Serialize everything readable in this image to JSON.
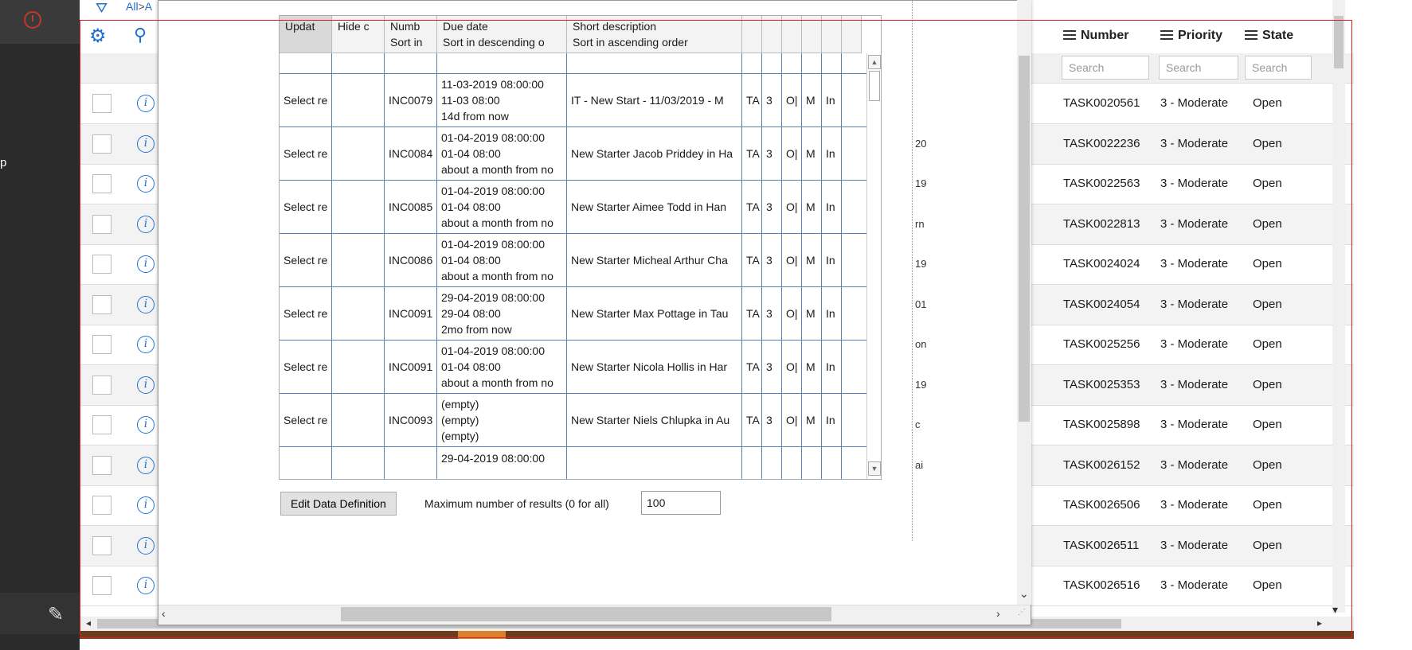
{
  "breadcrumb": {
    "all": "All",
    "sep": ">",
    "rest": "A"
  },
  "leftnav": {
    "partial_text": "p"
  },
  "background_list": {
    "columns": {
      "number": "Number",
      "priority": "Priority",
      "state": "State"
    },
    "search_placeholder": "Search",
    "rows": [
      {
        "number": "TASK0020561",
        "priority": "3 - Moderate",
        "state": "Open",
        "mid": "",
        "alt": false
      },
      {
        "number": "TASK0022236",
        "priority": "3 - Moderate",
        "state": "Open",
        "mid": "20",
        "alt": true
      },
      {
        "number": "TASK0022563",
        "priority": "3 - Moderate",
        "state": "Open",
        "mid": "19",
        "alt": false
      },
      {
        "number": "TASK0022813",
        "priority": "3 - Moderate",
        "state": "Open",
        "mid": "rn",
        "alt": true
      },
      {
        "number": "TASK0024024",
        "priority": "3 - Moderate",
        "state": "Open",
        "mid": "19",
        "alt": false
      },
      {
        "number": "TASK0024054",
        "priority": "3 - Moderate",
        "state": "Open",
        "mid": "01",
        "alt": true
      },
      {
        "number": "TASK0025256",
        "priority": "3 - Moderate",
        "state": "Open",
        "mid": "on",
        "alt": false
      },
      {
        "number": "TASK0025353",
        "priority": "3 - Moderate",
        "state": "Open",
        "mid": "19",
        "alt": true
      },
      {
        "number": "TASK0025898",
        "priority": "3 - Moderate",
        "state": "Open",
        "mid": "c",
        "alt": false
      },
      {
        "number": "TASK0026152",
        "priority": "3 - Moderate",
        "state": "Open",
        "mid": "ai",
        "alt": true
      },
      {
        "number": "TASK0026506",
        "priority": "3 - Moderate",
        "state": "Open",
        "mid": "",
        "alt": false
      },
      {
        "number": "TASK0026511",
        "priority": "3 - Moderate",
        "state": "Open",
        "mid": "",
        "alt": true
      },
      {
        "number": "TASK0026516",
        "priority": "3 - Moderate",
        "state": "Open",
        "mid": "",
        "alt": false
      }
    ]
  },
  "dialog": {
    "table": {
      "headers": [
        {
          "line1": "Updat",
          "line2": ""
        },
        {
          "line1": "Hide c",
          "line2": ""
        },
        {
          "line1": "Numb",
          "line2": "Sort in"
        },
        {
          "line1": "Due date",
          "line2": "Sort in descending o"
        },
        {
          "line1": "Short description",
          "line2": "Sort in ascending order"
        },
        {
          "line1": "",
          "line2": ""
        },
        {
          "line1": "",
          "line2": ""
        },
        {
          "line1": "",
          "line2": ""
        },
        {
          "line1": "",
          "line2": ""
        },
        {
          "line1": "",
          "line2": ""
        },
        {
          "line1": "",
          "line2": ""
        }
      ],
      "rows": [
        {
          "update": "Select re",
          "number": "INC0079",
          "due": [
            "11-03-2019 08:00:00",
            "11-03 08:00",
            "14d from now"
          ],
          "desc": "IT - New Start - 11/03/2019 - M",
          "c5": "TA",
          "c6": "3",
          "c7": "O|",
          "c8": "M",
          "c9": "In"
        },
        {
          "update": "Select re",
          "number": "INC0084",
          "due": [
            "01-04-2019 08:00:00",
            "01-04 08:00",
            "about a month from no"
          ],
          "desc": "New Starter Jacob Priddey in Ha",
          "c5": "TA",
          "c6": "3",
          "c7": "O|",
          "c8": "M",
          "c9": "In"
        },
        {
          "update": "Select re",
          "number": "INC0085",
          "due": [
            "01-04-2019 08:00:00",
            "01-04 08:00",
            "about a month from no"
          ],
          "desc": "New Starter Aimee Todd in Han",
          "c5": "TA",
          "c6": "3",
          "c7": "O|",
          "c8": "M",
          "c9": "In"
        },
        {
          "update": "Select re",
          "number": "INC0086",
          "due": [
            "01-04-2019 08:00:00",
            "01-04 08:00",
            "about a month from no"
          ],
          "desc": "New Starter Micheal Arthur Cha",
          "c5": "TA",
          "c6": "3",
          "c7": "O|",
          "c8": "M",
          "c9": "In"
        },
        {
          "update": "Select re",
          "number": "INC0091",
          "due": [
            "29-04-2019 08:00:00",
            "29-04 08:00",
            "2mo from now"
          ],
          "desc": "New Starter Max Pottage in Tau",
          "c5": "TA",
          "c6": "3",
          "c7": "O|",
          "c8": "M",
          "c9": "In"
        },
        {
          "update": "Select re",
          "number": "INC0091",
          "due": [
            "01-04-2019 08:00:00",
            "01-04 08:00",
            "about a month from no"
          ],
          "desc": "New Starter Nicola Hollis in Har",
          "c5": "TA",
          "c6": "3",
          "c7": "O|",
          "c8": "M",
          "c9": "In"
        },
        {
          "update": "Select re",
          "number": "INC0093",
          "due": [
            "(empty)",
            "(empty)",
            "(empty)"
          ],
          "desc": "New Starter Niels Chlupka in Au",
          "c5": "TA",
          "c6": "3",
          "c7": "O|",
          "c8": "M",
          "c9": "In"
        },
        {
          "update": "",
          "number": "",
          "due": [
            "29-04-2019 08:00:00",
            "",
            ""
          ],
          "desc": "",
          "c5": "",
          "c6": "",
          "c7": "",
          "c8": "",
          "c9": ""
        }
      ]
    },
    "edit_button": "Edit Data Definition",
    "max_label": "Maximum number of results (0 for all)",
    "max_value": "100"
  }
}
